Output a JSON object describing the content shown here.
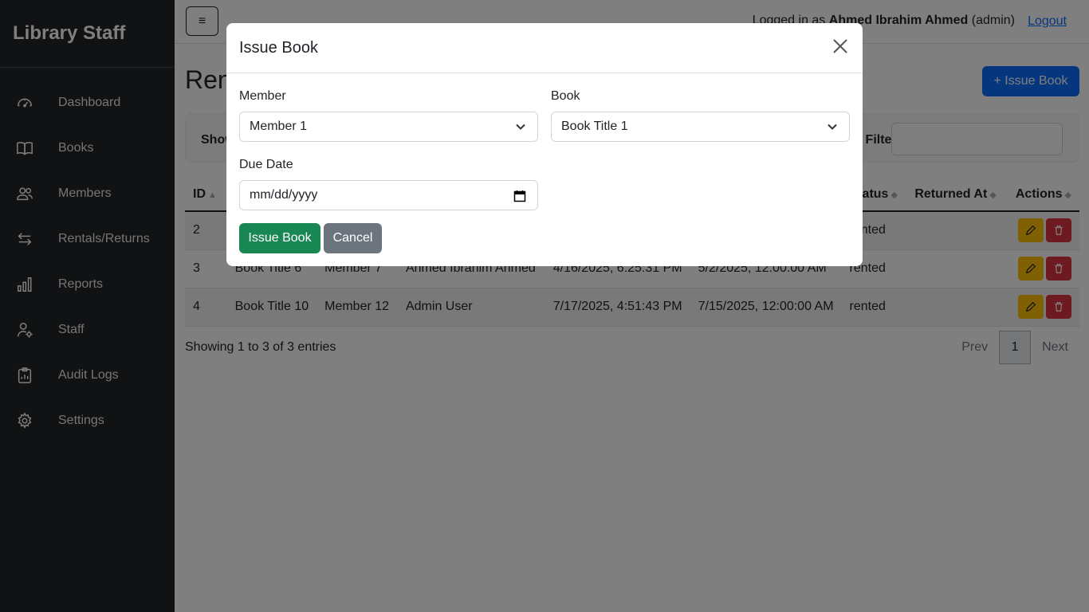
{
  "sidebar": {
    "brand": "Library Staff",
    "items": [
      {
        "label": "Dashboard",
        "icon": "dashboard-icon"
      },
      {
        "label": "Books",
        "icon": "book-icon"
      },
      {
        "label": "Members",
        "icon": "members-icon"
      },
      {
        "label": "Rentals/Returns",
        "icon": "exchange-icon"
      },
      {
        "label": "Reports",
        "icon": "bar-chart-icon"
      },
      {
        "label": "Staff",
        "icon": "staff-icon"
      },
      {
        "label": "Audit Logs",
        "icon": "clipboard-icon"
      },
      {
        "label": "Settings",
        "icon": "gear-icon"
      }
    ]
  },
  "header": {
    "toggle": "≡",
    "logged_in_prefix": "Logged in as",
    "user_name": "Ahmed Ibrahim Ahmed",
    "user_role": "(admin)",
    "logout": "Logout"
  },
  "page": {
    "title": "Rentals",
    "issue_button": "+ Issue Book",
    "show_label": "Show",
    "filter_label": "Filter:"
  },
  "table": {
    "columns": [
      "ID",
      "",
      "",
      "",
      "",
      "",
      "Status",
      "Returned At",
      "Actions"
    ],
    "rows": [
      {
        "id": "2",
        "book": "",
        "member": "",
        "staff": "",
        "rented": "",
        "due": "",
        "status": "rented",
        "returned": ""
      },
      {
        "id": "3",
        "book": "Book Title 6",
        "member": "Member 7",
        "staff": "Ahmed Ibrahim Ahmed",
        "rented": "4/16/2025, 6:25:31 PM",
        "due": "5/2/2025, 12:00:00 AM",
        "status": "rented",
        "returned": ""
      },
      {
        "id": "4",
        "book": "Book Title 10",
        "member": "Member 12",
        "staff": "Admin User",
        "rented": "7/17/2025, 4:51:43 PM",
        "due": "7/15/2025, 12:00:00 AM",
        "status": "rented",
        "returned": ""
      }
    ]
  },
  "footer": {
    "info": "Showing 1 to 3 of 3 entries",
    "prev": "Prev",
    "page": "1",
    "next": "Next"
  },
  "modal": {
    "title": "Issue Book",
    "member_label": "Member",
    "member_value": "Member 1",
    "book_label": "Book",
    "book_value": "Book Title 1",
    "due_label": "Due Date",
    "due_placeholder": "mm/dd/yyyy",
    "submit": "Issue Book",
    "cancel": "Cancel"
  }
}
